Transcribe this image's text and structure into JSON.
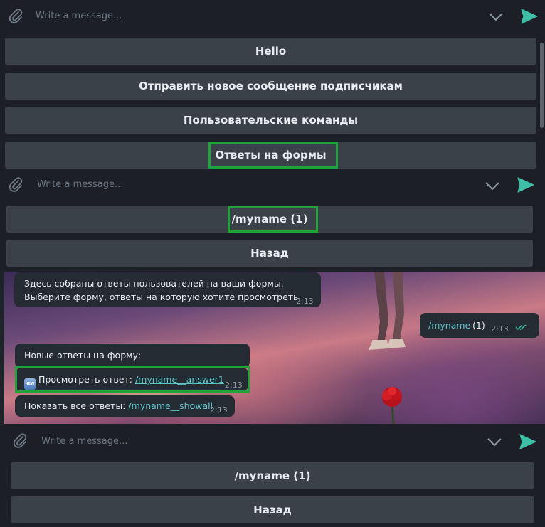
{
  "panel1": {
    "placeholder": "Write a message...",
    "buttons": [
      "Hello",
      "Отправить новое сообщение подписчикам",
      "Пользовательские команды",
      "Ответы на формы"
    ]
  },
  "panel2": {
    "placeholder": "Write a message...",
    "buttons": [
      "/myname (1)",
      "Назад"
    ]
  },
  "chat": {
    "msg1": {
      "lines": [
        "Здесь собраны ответы пользователей на ваши формы.",
        "Выберите форму, ответы на которую хотите просмотреть."
      ],
      "time": "2:13"
    },
    "outgoing": {
      "command": "/myname",
      "suffix": "(1)",
      "time": "2:13"
    },
    "msg2": {
      "text": "Новые ответы на форму:"
    },
    "msg3": {
      "badge": "NEW",
      "prefix": "Просмотреть ответ:",
      "link": "/myname__answer1",
      "time": "2:13"
    },
    "msg4": {
      "prefix": "Показать все ответы:",
      "link": "/myname__showall",
      "time": "2:13"
    }
  },
  "panel3": {
    "placeholder": "Write a message...",
    "buttons": [
      "/myname (1)",
      "Назад"
    ]
  },
  "colors": {
    "accent": "#3fbfa8",
    "highlight": "#1fa43a",
    "button": "#3a4149",
    "bubble": "#242b33"
  },
  "icons": [
    "paperclip-icon",
    "chevron-down-icon",
    "send-icon",
    "double-check-icon",
    "rose-icon"
  ]
}
